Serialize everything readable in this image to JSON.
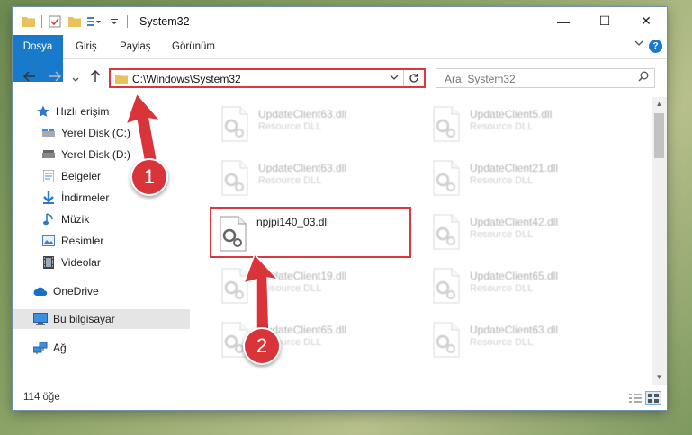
{
  "window": {
    "title": "System32",
    "controls": {
      "minimize": "—",
      "maximize": "☐",
      "close": "✕"
    }
  },
  "ribbon": {
    "tabs": [
      "Dosya",
      "Giriş",
      "Paylaş",
      "Görünüm"
    ],
    "help": "?"
  },
  "navigation": {
    "address": "C:\\Windows\\System32",
    "search_placeholder": "Ara: System32"
  },
  "sidebar": {
    "items": [
      {
        "label": "Hızlı erişim",
        "icon": "star-icon",
        "pinned": false
      },
      {
        "label": "Yerel Disk (C:)",
        "icon": "drive-icon",
        "pinned": true
      },
      {
        "label": "Yerel Disk (D:)",
        "icon": "drive-icon",
        "pinned": true
      },
      {
        "label": "Belgeler",
        "icon": "documents-icon",
        "pinned": true
      },
      {
        "label": "İndirmeler",
        "icon": "download-icon",
        "pinned": true
      },
      {
        "label": "Müzik",
        "icon": "music-icon",
        "pinned": true
      },
      {
        "label": "Resimler",
        "icon": "pictures-icon",
        "pinned": true
      },
      {
        "label": "Videolar",
        "icon": "videos-icon",
        "pinned": true
      },
      {
        "label": "OneDrive",
        "icon": "cloud-icon",
        "pinned": false
      },
      {
        "label": "Bu bilgisayar",
        "icon": "computer-icon",
        "pinned": false,
        "selected": true
      },
      {
        "label": "Ağ",
        "icon": "network-icon",
        "pinned": false
      }
    ]
  },
  "files": [
    {
      "name": "UpdateClient63.dll",
      "desc": "Resource DLL"
    },
    {
      "name": "UpdateClient5.dll",
      "desc": "Resource DLL"
    },
    {
      "name": "UpdateClient63.dll",
      "desc": "Resource DLL"
    },
    {
      "name": "UpdateClient21.dll",
      "desc": "Resource DLL"
    },
    {
      "name": "npjpi140_03.dll",
      "desc": "",
      "highlighted": true
    },
    {
      "name": "UpdateClient42.dll",
      "desc": "Resource DLL"
    },
    {
      "name": "UpdateClient19.dll",
      "desc": "Resource DLL"
    },
    {
      "name": "UpdateClient65.dll",
      "desc": "Resource DLL"
    },
    {
      "name": "UpdateClient65.dll",
      "desc": "Resource DLL"
    },
    {
      "name": "UpdateClient63.dll",
      "desc": "Resource DLL"
    }
  ],
  "status": {
    "count": "114 öğe"
  },
  "annotations": {
    "step1": "1",
    "step2": "2"
  },
  "colors": {
    "accent": "#1979ca",
    "annotation": "#d8343a"
  }
}
